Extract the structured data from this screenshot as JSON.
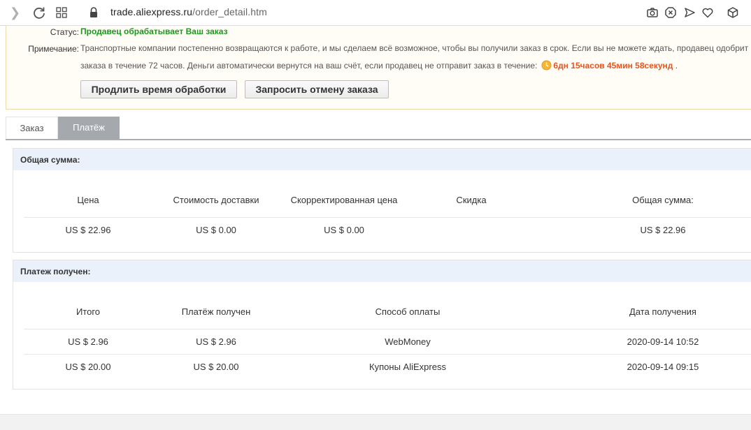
{
  "browser": {
    "url_host": "trade.aliexpress.ru",
    "url_path": "/order_detail.htm"
  },
  "status_panel": {
    "status_label": "Статус:",
    "status_value": "Продавец обрабатывает Ваш заказ",
    "note_label": "Примечание:",
    "note_line1": "Транспортные компании постепенно возвращаются к работе, и мы сделаем всё возможное, чтобы вы получили заказ в срок. Если вы не можете ждать, продавец одобрит",
    "note_line2": "заказа в течение 72 часов. Деньги автоматически вернутся на ваш счёт, если продавец не отправит заказ в течение:",
    "countdown": "6дн 15часов 45мин 58секунд",
    "countdown_suffix": " .",
    "extend_button": "Продлить время обработки",
    "cancel_button": "Запросить отмену заказа"
  },
  "tabs": {
    "order": "Заказ",
    "payment": "Платёж"
  },
  "total_section": {
    "title": "Общая сумма:",
    "headers": [
      "Цена",
      "Стоимость доставки",
      "Скорректированная цена",
      "Скидка",
      "Общая сумма:"
    ],
    "values": [
      "US $ 22.96",
      "US $ 0.00",
      "US $ 0.00",
      "",
      "US $ 22.96"
    ]
  },
  "payment_section": {
    "title": "Платеж получен:",
    "headers": [
      "Итого",
      "Платёж получен",
      "Способ оплаты",
      "Дата получения"
    ],
    "rows": [
      [
        "US $ 2.96",
        "US $ 2.96",
        "WebMoney",
        "2020-09-14 10:52"
      ],
      [
        "US $ 20.00",
        "US $ 20.00",
        "Купоны AliExpress",
        "2020-09-14 09:15"
      ]
    ]
  },
  "colors": {
    "status_green": "#1a9a1a",
    "countdown_orange": "#e8541c",
    "active_tab": "#a5a8ac",
    "section_header_bg": "#eaf1fb"
  }
}
